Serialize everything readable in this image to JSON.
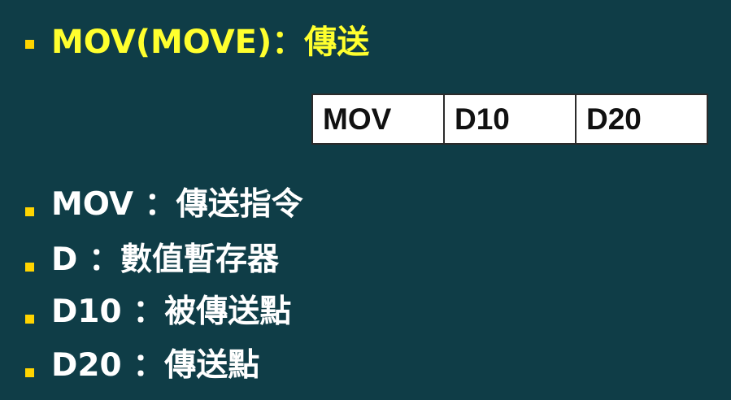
{
  "title": "MOV(MOVE)：傳送",
  "instruction_table": {
    "cells": [
      "MOV",
      "D10",
      "D20"
    ]
  },
  "items": [
    "MOV ：傳送指令",
    "D ：數值暫存器",
    "D10 ：被傳送點",
    "D20 ：傳送點"
  ],
  "colors": {
    "background": "#0f3d47",
    "bullet": "#ffd400",
    "title": "#ffff2e",
    "body_text": "#ffffff"
  }
}
